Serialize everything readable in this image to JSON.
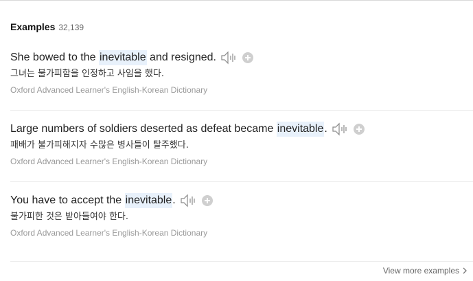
{
  "section": {
    "title": "Examples",
    "count": "32,139"
  },
  "examples": [
    {
      "pre": "She bowed to the ",
      "highlight": "inevitable",
      "post": " and resigned.",
      "translation": "그녀는 불가피함을 인정하고 사임을 했다.",
      "source": "Oxford Advanced Learner's English-Korean Dictionary"
    },
    {
      "pre": "Large numbers of soldiers deserted as defeat became ",
      "highlight": "inevitable",
      "post": ".",
      "translation": "패배가 불가피해지자 수많은 병사들이 탈주했다.",
      "source": "Oxford Advanced Learner's English-Korean Dictionary"
    },
    {
      "pre": "You have to accept the ",
      "highlight": "inevitable",
      "post": ".",
      "translation": "불가피한 것은 받아들여야 한다.",
      "source": "Oxford Advanced Learner's English-Korean Dictionary"
    }
  ],
  "footer": {
    "more_label": "View more examples"
  },
  "icons": {
    "audio": "speaker-icon",
    "add": "plus-circle-icon",
    "more": "chevron-right-icon"
  },
  "colors": {
    "highlight_bg": "#e8f1fb",
    "source_text": "#9a9a9a",
    "icon_gray": "#9a9a9a"
  }
}
